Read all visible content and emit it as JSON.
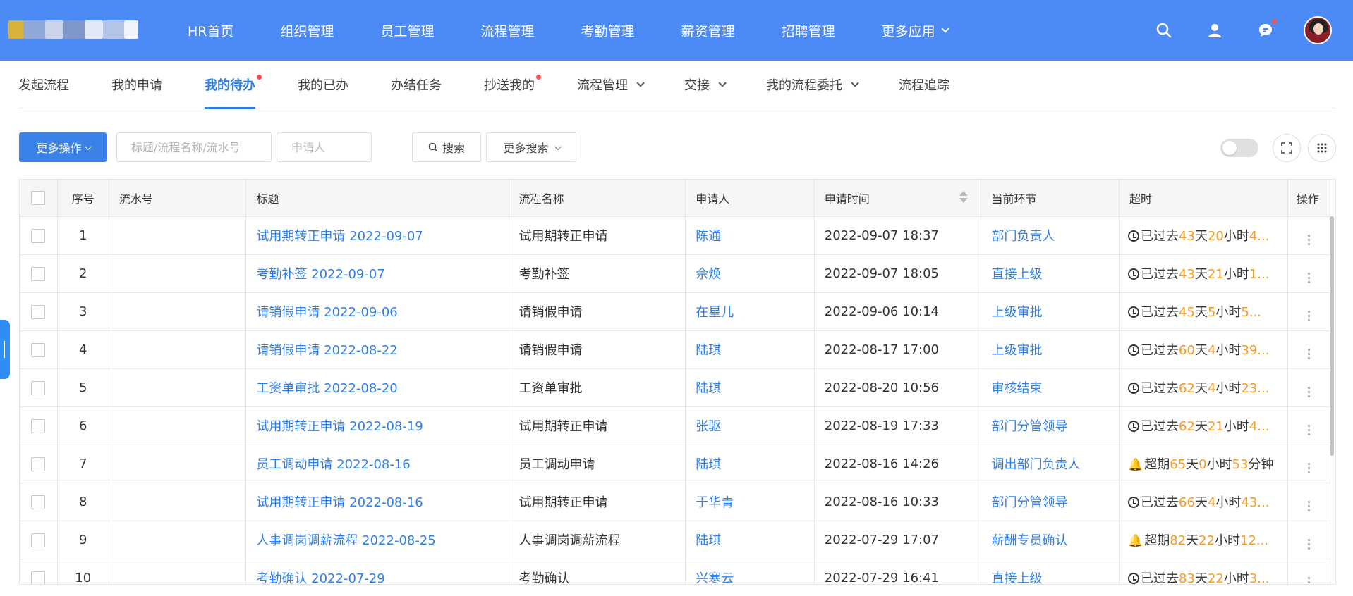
{
  "topnav": {
    "items": [
      {
        "label": "HR首页"
      },
      {
        "label": "组织管理"
      },
      {
        "label": "员工管理"
      },
      {
        "label": "流程管理"
      },
      {
        "label": "考勤管理"
      },
      {
        "label": "薪资管理"
      },
      {
        "label": "招聘管理"
      },
      {
        "label": "更多应用",
        "dropdown": true
      }
    ]
  },
  "subnav": {
    "tabs": [
      {
        "label": "发起流程"
      },
      {
        "label": "我的申请"
      },
      {
        "label": "我的待办",
        "active": true,
        "dot": true
      },
      {
        "label": "我的已办"
      },
      {
        "label": "办结任务"
      },
      {
        "label": "抄送我的",
        "dot": true
      },
      {
        "label": "流程管理",
        "dropdown": true
      },
      {
        "label": "交接",
        "dropdown": true
      },
      {
        "label": "我的流程委托",
        "dropdown": true
      },
      {
        "label": "流程追踪"
      }
    ]
  },
  "toolbar": {
    "more_ops_label": "更多操作",
    "title_placeholder": "标题/流程名称/流水号",
    "applicant_placeholder": "申请人",
    "search_label": "搜索",
    "more_search_label": "更多搜索"
  },
  "table": {
    "headers": {
      "seq": "序号",
      "serial": "流水号",
      "title": "标题",
      "flow": "流程名称",
      "applicant": "申请人",
      "time": "申请时间",
      "node": "当前环节",
      "timeout": "超时",
      "action": "操作"
    },
    "rows": [
      {
        "seq": "1",
        "serial": "",
        "title": "试用期转正申请 2022-09-07",
        "flow": "试用期转正申请",
        "applicant": "陈通",
        "time": "2022-09-07 18:37",
        "node": "部门负责人",
        "timeout": {
          "type": "clock",
          "prefix": "已过去",
          "d": "43",
          "h": "20",
          "rest": "4..."
        }
      },
      {
        "seq": "2",
        "serial": "",
        "title": "考勤补签 2022-09-07",
        "flow": "考勤补签",
        "applicant": "佘焕",
        "time": "2022-09-07 18:05",
        "node": "直接上级",
        "timeout": {
          "type": "clock",
          "prefix": "已过去",
          "d": "43",
          "h": "21",
          "rest": "1..."
        }
      },
      {
        "seq": "3",
        "serial": "",
        "title": "请销假申请 2022-09-06",
        "flow": "请销假申请",
        "applicant": "在星儿",
        "time": "2022-09-06 10:14",
        "node": "上级审批",
        "timeout": {
          "type": "clock",
          "prefix": "已过去",
          "d": "45",
          "h": "5",
          "rest": "5..."
        }
      },
      {
        "seq": "4",
        "serial": "",
        "title": "请销假申请 2022-08-22",
        "flow": "请销假申请",
        "applicant": "陆琪",
        "time": "2022-08-17 17:00",
        "node": "上级审批",
        "timeout": {
          "type": "clock",
          "prefix": "已过去",
          "d": "60",
          "h": "4",
          "rest": "39..."
        }
      },
      {
        "seq": "5",
        "serial": "",
        "title": "工资单审批 2022-08-20",
        "flow": "工资单审批",
        "applicant": "陆琪",
        "time": "2022-08-20 10:56",
        "node": "审核结束",
        "timeout": {
          "type": "clock",
          "prefix": "已过去",
          "d": "62",
          "h": "4",
          "rest": "23..."
        }
      },
      {
        "seq": "6",
        "serial": "",
        "title": "试用期转正申请 2022-08-19",
        "flow": "试用期转正申请",
        "applicant": "张驱",
        "time": "2022-08-19 17:33",
        "node": "部门分管领导",
        "timeout": {
          "type": "clock",
          "prefix": "已过去",
          "d": "62",
          "h": "21",
          "rest": "4..."
        }
      },
      {
        "seq": "7",
        "serial": "",
        "title": "员工调动申请 2022-08-16",
        "flow": "员工调动申请",
        "applicant": "陆琪",
        "time": "2022-08-16 14:26",
        "node": "调出部门负责人",
        "timeout": {
          "type": "bell",
          "prefix": "超期",
          "d": "65",
          "h": "0",
          "m": "53",
          "rest": "分钟"
        }
      },
      {
        "seq": "8",
        "serial": "",
        "title": "试用期转正申请 2022-08-16",
        "flow": "试用期转正申请",
        "applicant": "于华青",
        "time": "2022-08-16 10:33",
        "node": "部门分管领导",
        "timeout": {
          "type": "clock",
          "prefix": "已过去",
          "d": "66",
          "h": "4",
          "rest": "43..."
        }
      },
      {
        "seq": "9",
        "serial": "",
        "title": "人事调岗调薪流程 2022-08-25",
        "flow": "人事调岗调薪流程",
        "applicant": "陆琪",
        "time": "2022-07-29 17:07",
        "node": "薪酬专员确认",
        "timeout": {
          "type": "bell",
          "prefix": "超期",
          "d": "82",
          "h": "22",
          "rest": "12..."
        }
      },
      {
        "seq": "10",
        "serial": "",
        "title": "考勤确认 2022-07-29",
        "flow": "考勤确认",
        "applicant": "兴寒云",
        "time": "2022-07-29 16:41",
        "node": "直接上级",
        "timeout": {
          "type": "clock",
          "prefix": "已过去",
          "d": "83",
          "h": "22",
          "rest": "3..."
        }
      }
    ]
  },
  "units": {
    "day": "天",
    "hour": "小时"
  },
  "colors": {
    "topbar": "#4c8bf5",
    "accent": "#2f7fe8",
    "orange": "#f59a23",
    "danger": "#e8453c"
  }
}
